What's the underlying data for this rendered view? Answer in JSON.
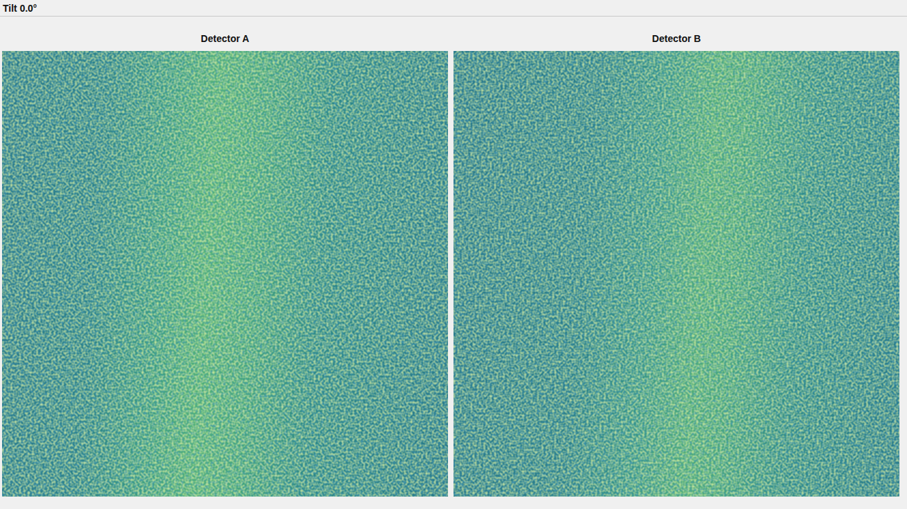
{
  "header": {
    "title": "Tilt 0.0°"
  },
  "detectors": [
    {
      "title": "Detector A"
    },
    {
      "title": "Detector B"
    }
  ]
}
